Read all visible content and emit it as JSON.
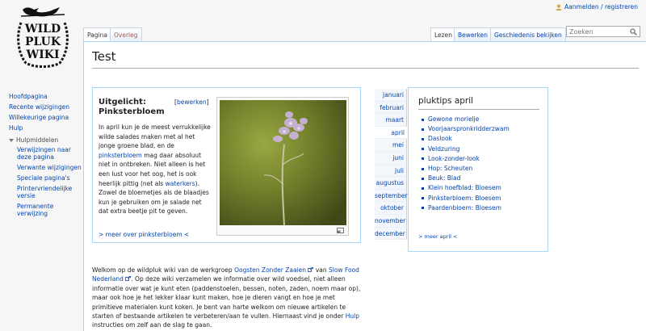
{
  "logo": {
    "lines": [
      "WILD",
      "PLUK",
      "WIKI"
    ]
  },
  "personal": {
    "login_label": "Aanmelden / registreren"
  },
  "tabs": {
    "pagina": "Pagina",
    "overleg": "Overleg",
    "lezen": "Lezen",
    "bewerken": "Bewerken",
    "geschiedenis": "Geschiedenis bekijken"
  },
  "search": {
    "placeholder": "Zoeken"
  },
  "sidebar": {
    "nav": [
      "Hoofdpagina",
      "Recente wijzigingen",
      "Willekeurige pagina",
      "Hulp"
    ],
    "tools_heading": "Hulpmiddelen",
    "tools": [
      "Verwijzingen naar deze pagina",
      "Verwante wijzigingen",
      "Speciale pagina's",
      "Printervriendelijke versie",
      "Permanente verwijzing"
    ]
  },
  "page": {
    "title": "Test"
  },
  "featured": {
    "title": "Uitgelicht: Pinksterbloem",
    "edit_open": "[",
    "edit_label": "bewerken",
    "edit_close": "]",
    "text_1": "In april kun je de meest verrukkelijke wilde salades maken met al het jonge groene blad, en de ",
    "link_1": "pinksterbloem",
    "text_2": " mag daar absoluut niet in ontbreken. Niet alleen is het een lust voor het oog, het is ook heerlijk pittig (net als ",
    "link_2": "waterkers",
    "text_3": "). Zowel de bloemetjes als de blaadjes kun je gebruiken om je salade net dat extra beetje pit te geven.",
    "more": "> meer over pinksterbloem <"
  },
  "months": [
    "januari",
    "februari",
    "maart",
    "april",
    "mei",
    "juni",
    "juli",
    "augustus",
    "september",
    "oktober",
    "november",
    "december"
  ],
  "tips": {
    "title": "pluktips april",
    "items": [
      "Gewone morielje",
      "Voorjaarspronkridderzwam",
      "Daslook",
      "Veldzuring",
      "Look-zonder-look",
      "Hop: Scheuten",
      "Beuk: Blad",
      "Klein hoefblad: Bloesem",
      "Pinksterbloem: Bloesem",
      "Paardenbloem: Bloesem"
    ],
    "more": "> meer april <"
  },
  "intro": {
    "t1": "Welkom op de wildpluk wiki van de werkgroep ",
    "l1": "Oogsten Zonder Zaaien",
    "t2": " van ",
    "l2": "Slow Food Nederland",
    "t3": ". Op deze wiki verzamelen we informatie over wild voedsel, niet alleen informatie over wat je kunt eten (paddenstoelen, bessen, noten, zaden, noem maar op), maar ook hoe je het lekker klaar kunt maken, hoe je dieren vangt en hoe je met primitieve materialen kunt koken. Je bent van harte welkom om nieuwe artikelen te starten of bestaande artikelen te verbeteren/aan te vullen. Hiernaast vind je onder ",
    "l3": "Hulp",
    "t4": " instructies om zelf aan de slag te gaan."
  },
  "colors": {
    "link": "#0645ad",
    "border": "#a7d7f9",
    "overleg": "#a55858"
  }
}
